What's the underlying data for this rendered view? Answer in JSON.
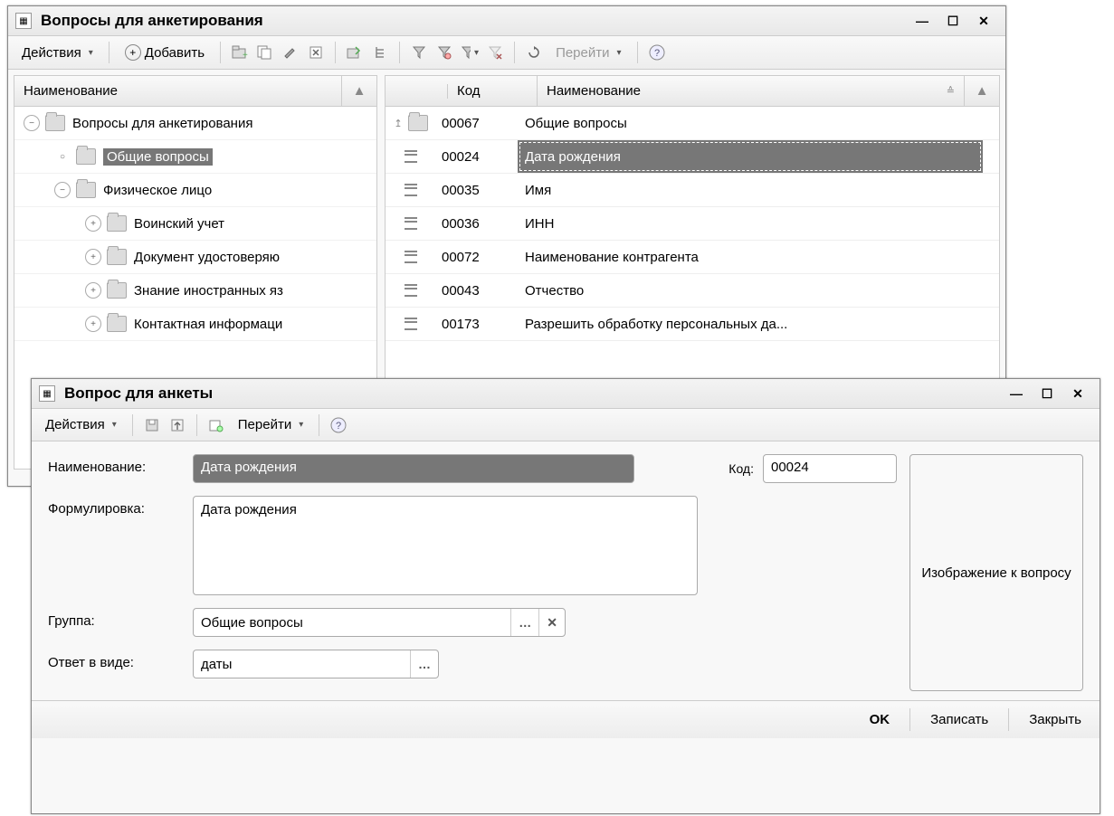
{
  "window1": {
    "title": "Вопросы для анкетирования",
    "toolbar": {
      "actions": "Действия",
      "add": "Добавить",
      "goto": "Перейти"
    },
    "tree": {
      "header": "Наименование",
      "nodes": {
        "root": "Вопросы для анкетирования",
        "general": "Общие вопросы",
        "person": "Физическое лицо",
        "military": "Воинский учет",
        "identity": "Документ удостоверяю",
        "languages": "Знание иностранных яз",
        "contact": "Контактная информаци"
      }
    },
    "table": {
      "header_code": "Код",
      "header_name": "Наименование",
      "rows": [
        {
          "code": "00067",
          "name": "Общие вопросы",
          "type": "folder"
        },
        {
          "code": "00024",
          "name": "Дата рождения",
          "type": "item",
          "selected": true
        },
        {
          "code": "00035",
          "name": "Имя",
          "type": "item"
        },
        {
          "code": "00036",
          "name": "ИНН",
          "type": "item"
        },
        {
          "code": "00072",
          "name": "Наименование контрагента",
          "type": "item"
        },
        {
          "code": "00043",
          "name": "Отчество",
          "type": "item"
        },
        {
          "code": "00173",
          "name": "Разрешить обработку персональных да...",
          "type": "item"
        }
      ]
    }
  },
  "window2": {
    "title": "Вопрос для анкеты",
    "toolbar": {
      "actions": "Действия",
      "goto": "Перейти"
    },
    "form": {
      "name_label": "Наименование:",
      "name_value": "Дата рождения",
      "code_label": "Код:",
      "code_value": "00024",
      "wording_label": "Формулировка:",
      "wording_value": "Дата рождения",
      "group_label": "Группа:",
      "group_value": "Общие вопросы",
      "answer_label": "Ответ в виде:",
      "answer_value": "даты",
      "image_box": "Изображение к вопросу"
    },
    "footer": {
      "ok": "OK",
      "save": "Записать",
      "close": "Закрыть"
    }
  }
}
